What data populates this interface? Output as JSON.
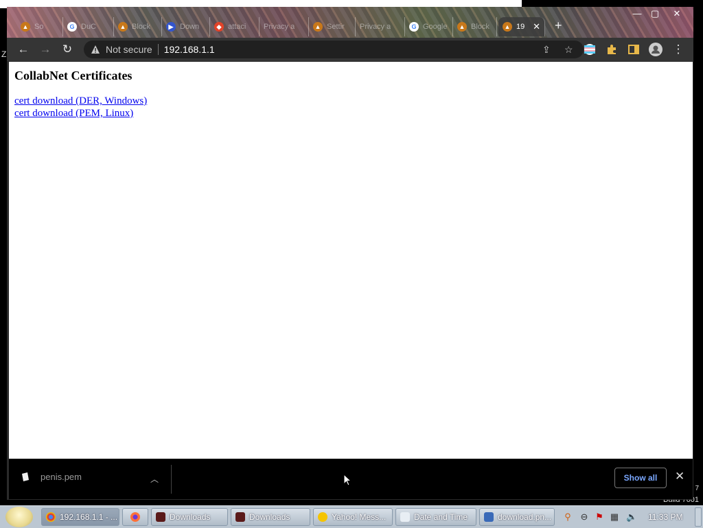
{
  "browser": {
    "tabs": [
      {
        "title": "So",
        "favicon": "brave-lion-icon"
      },
      {
        "title": "DuC",
        "favicon": "google-icon"
      },
      {
        "title": "Block",
        "favicon": "brave-lion-icon"
      },
      {
        "title": "Down",
        "favicon": "download-page-icon"
      },
      {
        "title": "attaci",
        "favicon": "gitlab-icon"
      },
      {
        "title": "Privacy a",
        "favicon": "generic-page-icon"
      },
      {
        "title": "Settir",
        "favicon": "brave-lion-icon"
      },
      {
        "title": "Privacy a",
        "favicon": "generic-page-icon"
      },
      {
        "title": "Google",
        "favicon": "google-icon"
      },
      {
        "title": "Block",
        "favicon": "brave-lion-icon"
      },
      {
        "title": "19",
        "favicon": "brave-lion-icon",
        "active": true
      }
    ],
    "toolbar": {
      "security_label": "Not secure",
      "url": "192.168.1.1"
    }
  },
  "page": {
    "heading": "CollabNet Certificates",
    "links": [
      "cert download (DER, Windows)",
      "cert download (PEM, Linux)"
    ]
  },
  "download_shelf": {
    "file_name": "penis.pem",
    "show_all_label": "Show all"
  },
  "desktop": {
    "edge_letter": "Z",
    "build_text": "Build 7601",
    "side_digit": "7"
  },
  "taskbar": {
    "tasks": [
      {
        "label": "192.168.1.1 - ...",
        "icon": "chrome-icon",
        "active": true
      },
      {
        "label": "",
        "icon": "firefox-icon"
      },
      {
        "label": "Downloads",
        "icon": "folder-downloads-icon"
      },
      {
        "label": "Downloads",
        "icon": "folder-downloads-icon"
      },
      {
        "label": "Yahoo! Mess...",
        "icon": "yahoo-messenger-icon"
      },
      {
        "label": "Date and Time",
        "icon": "clock-icon"
      },
      {
        "label": "download.pn...",
        "icon": "image-viewer-icon"
      }
    ],
    "clock": "11:33 PM"
  },
  "colors": {
    "link": "#0000ee",
    "show_all_text": "#7aa7ff",
    "toolbar_bg": "#353535",
    "taskbar_bg": "#bcc7d2"
  }
}
